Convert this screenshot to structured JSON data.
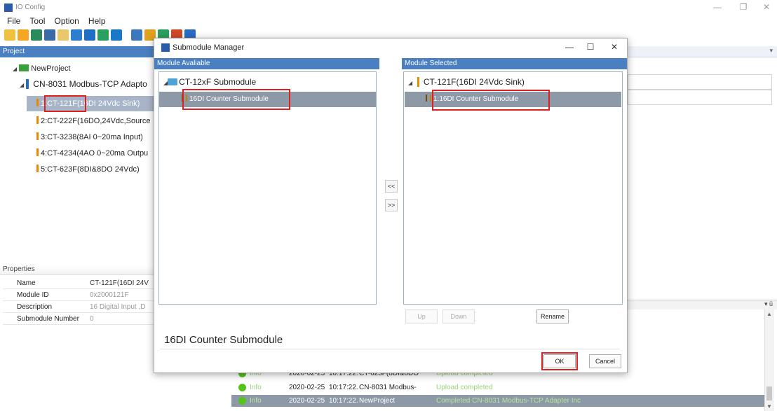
{
  "app": {
    "title": "IO Config"
  },
  "menu": [
    "File",
    "Tool",
    "Option",
    "Help"
  ],
  "project": {
    "header": "Project",
    "root": "NewProject",
    "adapter": "CN-8031 Modbus-TCP Adapto",
    "modules": [
      "1:CT-121F(16DI 24Vdc Sink)",
      "2:CT-222F(16DO,24Vdc,Source",
      "3:CT-3238(8AI 0~20ma Input)",
      "4:CT-4234(4AO 0~20ma Outpu",
      "5:CT-623F(8DI&8DO 24Vdc)"
    ]
  },
  "properties": {
    "header": "Properties",
    "rows": [
      {
        "name": "Name",
        "value": "CT-121F(16DI 24V"
      },
      {
        "name": "Module ID",
        "value": "0x2000121F"
      },
      {
        "name": "Description",
        "value": "16 Digital Input ,D"
      },
      {
        "name": "Submodule Number",
        "value": "0"
      }
    ]
  },
  "log": [
    {
      "level": "Info",
      "date": "2020-02-25",
      "time": "10:17:22.",
      "source": "CT-623F(8DI&8DO",
      "message": "Upload completed"
    },
    {
      "level": "Info",
      "date": "2020-02-25",
      "time": "10:17:22.",
      "source": "CN-8031 Modbus-",
      "message": "Upload completed"
    },
    {
      "level": "Info",
      "date": "2020-02-25",
      "time": "10:17:22.",
      "source": "NewProject",
      "message": "Completed CN-8031 Modbus-TCP Adapter Inc"
    }
  ],
  "dialog": {
    "title": "Submodule Manager",
    "available_header": "Module Avaliable",
    "available_group": "CT-12xF Submodule",
    "available_item": "16DI Counter Submodule",
    "selected_header": "Module Selected",
    "selected_group": "CT-121F(16DI 24Vdc Sink)",
    "selected_item": "1:16DI Counter Submodule",
    "move_left": "<<",
    "move_right": ">>",
    "up_label": "Up",
    "down_label": "Down",
    "rename_label": "Rename",
    "name_value": "16DI Counter Submodule",
    "ok_label": "OK",
    "cancel_label": "Cancel"
  },
  "colors": {
    "header_blue": "#4a7fc1",
    "selection": "#8e99a8",
    "highlight_red": "#e02020",
    "status_green": "#52c41a"
  }
}
